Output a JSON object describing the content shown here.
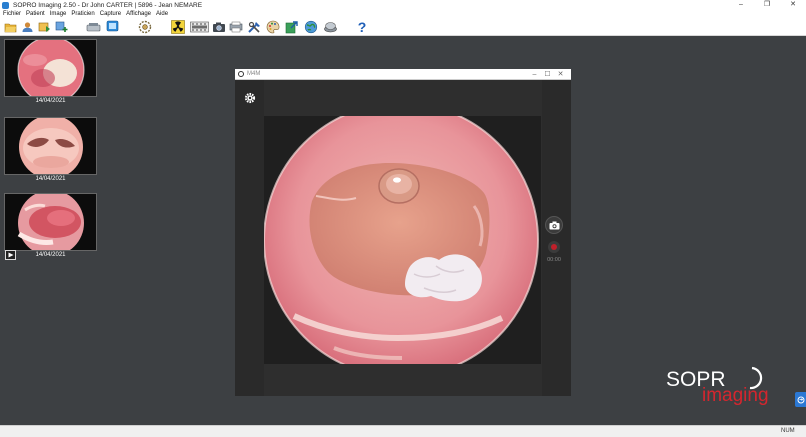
{
  "window": {
    "title": "SOPRO Imaging 2.50 - Dr John CARTER | 5896 - Jean NEMARE",
    "controls": {
      "minimize": "–",
      "maximize": "❐",
      "close": "✕"
    }
  },
  "menu": {
    "items": [
      "Fichier",
      "Patient",
      "Image",
      "Praticien",
      "Capture",
      "Affichage",
      "Aide"
    ]
  },
  "toolbar": {
    "icons": [
      "open-folder-icon",
      "patient-icon",
      "import-icon",
      "add-image-icon",
      "scanner-icon",
      "tablet-icon",
      "settings-wheel-icon",
      "radiation-icon",
      "film-icon",
      "camera-icon",
      "photo-print-icon",
      "tools-icon",
      "palette-icon",
      "export-icon",
      "globe-icon",
      "speaker-icon",
      "help-icon"
    ]
  },
  "thumbnails": [
    {
      "date": "14/04/2021"
    },
    {
      "date": "14/04/2021"
    },
    {
      "date": "14/04/2021"
    }
  ],
  "dialog": {
    "title": "M4M",
    "controls": {
      "minimize": "–",
      "maximize": "☐",
      "close": "✕"
    },
    "record_time": "00:00"
  },
  "logo": {
    "line1": "SOPR",
    "line2": "imaging"
  },
  "status": {
    "num": "NUM"
  },
  "colors": {
    "workspace": "#3d4043",
    "accent_blue": "#2b78d4",
    "brand_red": "#d4262e",
    "record_red": "#c0202a"
  }
}
